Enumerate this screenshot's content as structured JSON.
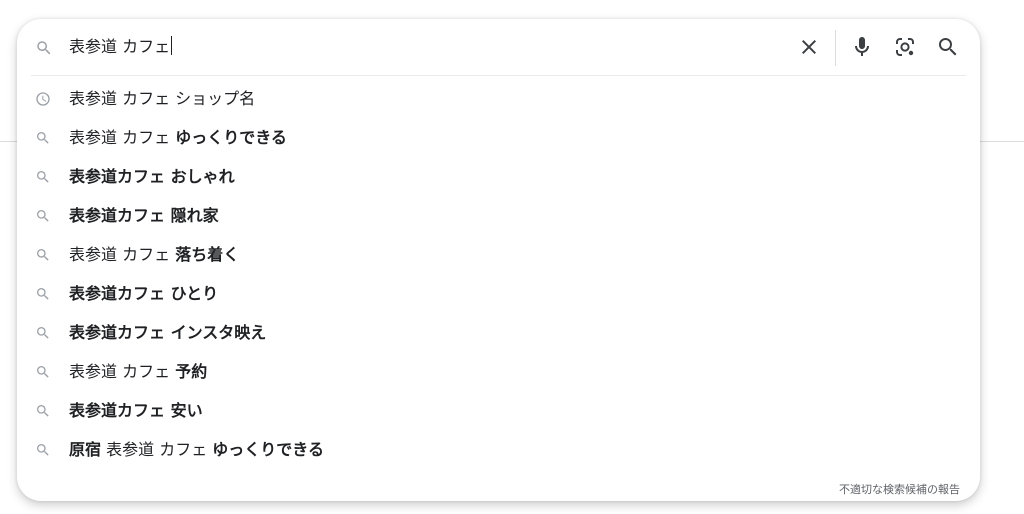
{
  "search": {
    "query": "表参道 カフェ",
    "clear_icon": "close-icon",
    "voice_icon": "microphone-icon",
    "lens_icon": "camera-lens-icon",
    "search_icon": "magnifier-icon"
  },
  "suggestions": [
    {
      "icon": "history-clock-icon",
      "plain": "表参道 カフェ ショップ名",
      "bold": ""
    },
    {
      "icon": "magnifier-icon",
      "plain": "表参道 カフェ ",
      "bold": "ゆっくりできる"
    },
    {
      "icon": "magnifier-icon",
      "plain": "",
      "bold": "表参道カフェ おしゃれ"
    },
    {
      "icon": "magnifier-icon",
      "plain": "",
      "bold": "表参道カフェ 隠れ家"
    },
    {
      "icon": "magnifier-icon",
      "plain": "表参道 カフェ ",
      "bold": "落ち着く"
    },
    {
      "icon": "magnifier-icon",
      "plain": "",
      "bold": "表参道カフェ ひとり"
    },
    {
      "icon": "magnifier-icon",
      "plain": "",
      "bold": "表参道カフェ インスタ映え"
    },
    {
      "icon": "magnifier-icon",
      "plain": "表参道 カフェ ",
      "bold": "予約"
    },
    {
      "icon": "magnifier-icon",
      "plain": "",
      "bold": "表参道カフェ 安い"
    },
    {
      "icon": "magnifier-icon",
      "prefix_bold": "原宿",
      "plain": " 表参道 カフェ ",
      "bold": "ゆっくりできる"
    }
  ],
  "footer": {
    "report_label": "不適切な検索候補の報告"
  },
  "colors": {
    "text": "#202124",
    "icon_gray": "#70757a",
    "accent_icon": "#3c4043",
    "divider": "#dadce0"
  }
}
